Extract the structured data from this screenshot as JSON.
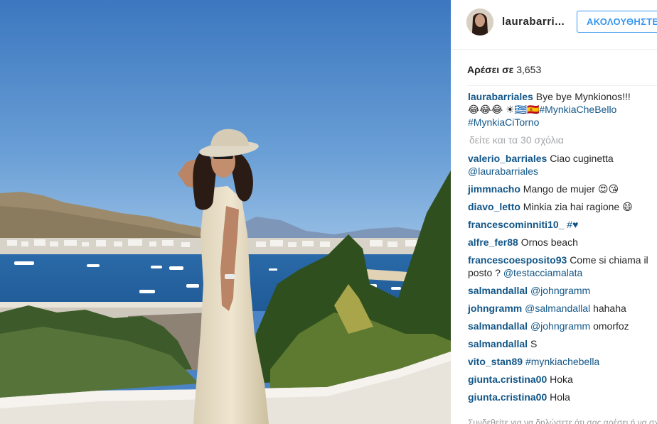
{
  "post": {
    "username": "laurabarri...",
    "follow_label": "ΑΚΟΛΟΥΘΗΣΤΕ",
    "likes_label": "Αρέσει σε",
    "likes_count": "3,653"
  },
  "caption": {
    "username": "laurabarriales",
    "text": "Bye bye Mynkionos!!!",
    "line2": "😂😂😂 ☀🇬🇷🇪🇸",
    "hashtag1": "#MynkiaCheBello",
    "hashtag2": "#MynkiaCiTorno"
  },
  "view_all_comments": "δείτε και τα 30 σχόλια",
  "comments": [
    {
      "user": "valerio_barriales",
      "text": "Ciao cuginetta",
      "mention": "@laurabarriales",
      "after": ""
    },
    {
      "user": "jimmnacho",
      "text": "Mango de mujer 😍😘",
      "mention": "",
      "after": ""
    },
    {
      "user": "diavo_letto",
      "text": "Minkia zia hai ragione 😄",
      "mention": "",
      "after": ""
    },
    {
      "user": "francescominniti10_",
      "text": "",
      "mention": "#♥",
      "after": ""
    },
    {
      "user": "alfre_fer88",
      "text": "Ornos beach",
      "mention": "",
      "after": ""
    },
    {
      "user": "francescoesposito93",
      "text": "Come si chiama il posto ?",
      "mention": "@testacciamalata",
      "after": ""
    },
    {
      "user": "salmandallal",
      "text": "",
      "mention": "@johngramm",
      "after": ""
    },
    {
      "user": "johngramm",
      "text": "",
      "mention": "@salmandallal",
      "after": "hahaha"
    },
    {
      "user": "salmandallal",
      "text": "",
      "mention": "@johngramm",
      "after": "omorfoz"
    },
    {
      "user": "salmandallal",
      "text": "S",
      "mention": "",
      "after": ""
    },
    {
      "user": "vito_stan89",
      "text": "",
      "mention": "#mynkiachebella",
      "after": ""
    },
    {
      "user": "giunta.cristina00",
      "text": "Hoka",
      "mention": "",
      "after": ""
    },
    {
      "user": "giunta.cristina00",
      "text": "Hola",
      "mention": "",
      "after": ""
    }
  ],
  "footer_truncated": "Συνδεθείτε για να δηλώσετε ότι σας αρέσει ή να σχολιάσετε.",
  "colors": {
    "accent": "#3897f0",
    "username": "#125688",
    "muted": "#a5a7aa",
    "sky": "#4a83c6",
    "sea": "#2d6fa8"
  },
  "icons": {
    "avatar": "profile-photo"
  }
}
